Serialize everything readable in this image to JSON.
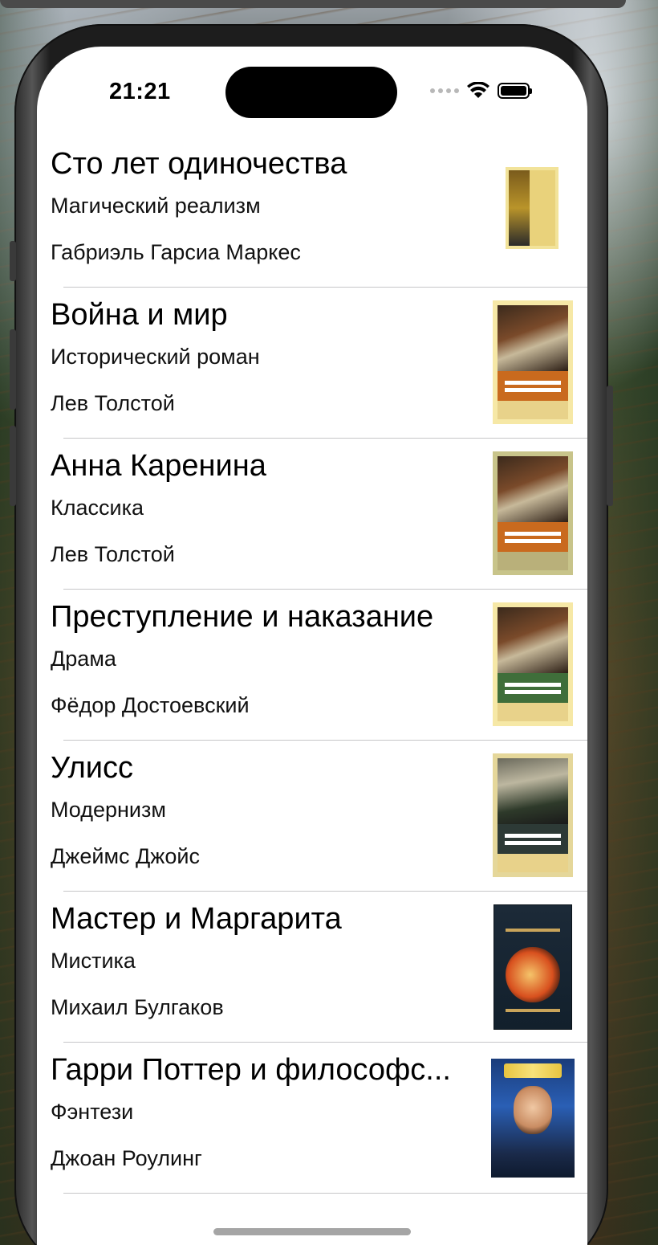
{
  "status_bar": {
    "time": "21:21",
    "icons": [
      "signal-dots-icon",
      "wifi-icon",
      "battery-icon"
    ]
  },
  "books": [
    {
      "title": "Сто лет одиночества",
      "genre": "Магический реализм",
      "author": "Габриэль Гарсиа Маркес",
      "cover_style": "marquez"
    },
    {
      "title": "Война и мир",
      "genre": "Исторический роман",
      "author": "Лев Толстой",
      "cover_style": "eksmo-orange"
    },
    {
      "title": "Анна Каренина",
      "genre": "Классика",
      "author": "Лев Толстой",
      "cover_style": "eksmo-orange"
    },
    {
      "title": "Преступление и наказание",
      "genre": "Драма",
      "author": "Фёдор Достоевский",
      "cover_style": "eksmo-green"
    },
    {
      "title": "Улисс",
      "genre": "Модернизм",
      "author": "Джеймс Джойс",
      "cover_style": "eksmo-grey"
    },
    {
      "title": "Мастер и Маргарита",
      "genre": "Мистика",
      "author": "Михаил Булгаков",
      "cover_style": "bulgakov"
    },
    {
      "title": "Гарри Поттер и философс...",
      "genre": "Фэнтези",
      "author": "Джоан Роулинг",
      "cover_style": "potter"
    }
  ],
  "colors": {
    "separator": "#c6c6c8",
    "background": "#ffffff",
    "text": "#000000"
  }
}
